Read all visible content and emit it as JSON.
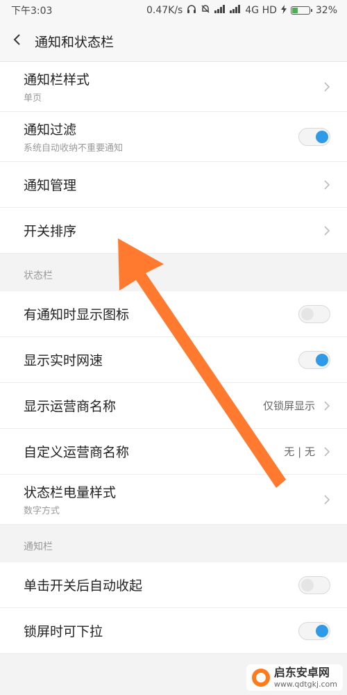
{
  "status_bar": {
    "time": "下午3:03",
    "speed": "0.47K/s",
    "network": "4G HD",
    "battery": "32%"
  },
  "header": {
    "title": "通知和状态栏"
  },
  "group1": {
    "rows": [
      {
        "label": "通知栏样式",
        "sub": "单页"
      },
      {
        "label": "通知过滤",
        "sub": "系统自动收纳不重要通知"
      },
      {
        "label": "通知管理"
      },
      {
        "label": "开关排序"
      }
    ]
  },
  "section_statusbar": {
    "header": "状态栏",
    "rows": [
      {
        "label": "有通知时显示图标"
      },
      {
        "label": "显示实时网速"
      },
      {
        "label": "显示运营商名称",
        "value": "仅锁屏显示"
      },
      {
        "label": "自定义运营商名称",
        "value": "无 | 无"
      },
      {
        "label": "状态栏电量样式",
        "sub": "数字方式"
      }
    ]
  },
  "section_notification": {
    "header": "通知栏",
    "rows": [
      {
        "label": "单击开关后自动收起"
      },
      {
        "label": "锁屏时可下拉"
      }
    ]
  },
  "toggles": {
    "notification_filter": true,
    "show_icon_on_notification": false,
    "show_realtime_speed": true,
    "auto_collapse": false,
    "pull_down_lockscreen": true
  },
  "watermark": {
    "title": "启东安卓网",
    "url": "www.qdtgkj.com"
  },
  "colors": {
    "accent": "#2f9be8",
    "arrow": "#ff7a2f",
    "background": "#f3f3f3"
  },
  "icons": {
    "back": "chevron-left-icon",
    "row_more": "chevron-right-icon",
    "headphones": "headphones-icon",
    "mute": "mute-icon",
    "signal": "signal-icon",
    "charging": "lightning-icon",
    "battery": "battery-icon"
  }
}
